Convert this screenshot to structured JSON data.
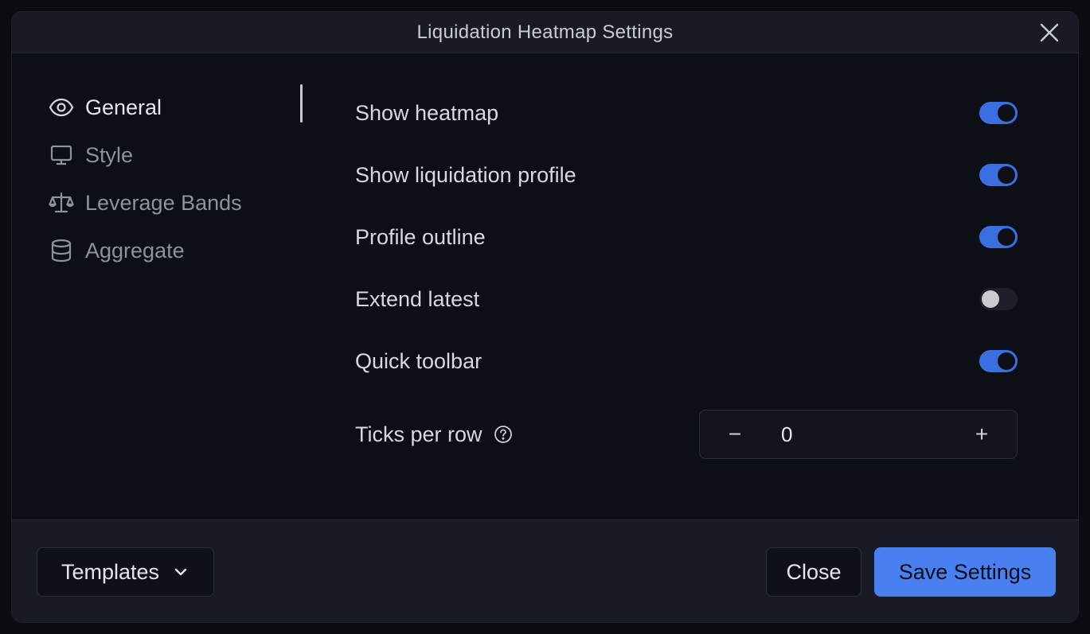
{
  "dialog": {
    "title": "Liquidation Heatmap Settings"
  },
  "sidebar": {
    "items": [
      {
        "label": "General",
        "icon": "eye-icon",
        "active": true
      },
      {
        "label": "Style",
        "icon": "monitor-icon",
        "active": false
      },
      {
        "label": "Leverage Bands",
        "icon": "scale-icon",
        "active": false
      },
      {
        "label": "Aggregate",
        "icon": "database-icon",
        "active": false
      }
    ]
  },
  "settings": {
    "toggles": [
      {
        "label": "Show heatmap",
        "on": true
      },
      {
        "label": "Show liquidation profile",
        "on": true
      },
      {
        "label": "Profile outline",
        "on": true
      },
      {
        "label": "Extend latest",
        "on": false
      },
      {
        "label": "Quick toolbar",
        "on": true
      }
    ],
    "ticks": {
      "label": "Ticks per row",
      "value": "0",
      "minus": "−",
      "plus": "+"
    }
  },
  "footer": {
    "templates_label": "Templates",
    "close_label": "Close",
    "save_label": "Save Settings"
  },
  "colors": {
    "accent": "#4a7ff0",
    "toggle_on": "#3b6fe0",
    "background": "#0c0f15",
    "panel": "#181b23"
  }
}
